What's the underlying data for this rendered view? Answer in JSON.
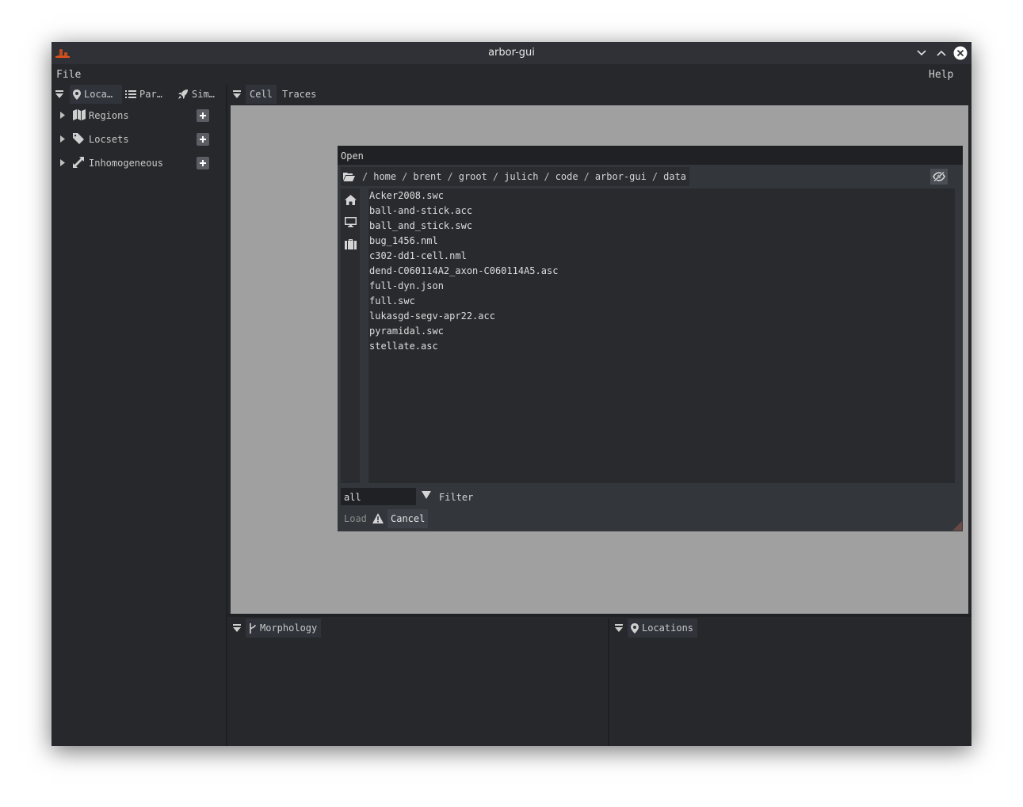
{
  "window": {
    "title": "arbor-gui"
  },
  "menu": {
    "file": "File",
    "help": "Help"
  },
  "left_panel": {
    "tabs": [
      {
        "label": "Loca…",
        "icon": "map-marker-icon"
      },
      {
        "label": "Par…",
        "icon": "list-icon"
      },
      {
        "label": "Sim…",
        "icon": "rocket-icon"
      }
    ],
    "tree": [
      {
        "label": "Regions",
        "icon": "map-icon"
      },
      {
        "label": "Locsets",
        "icon": "tag-icon"
      },
      {
        "label": "Inhomogeneous",
        "icon": "expand-arrows-icon"
      }
    ]
  },
  "center_panel": {
    "tabs": [
      "Cell",
      "Traces"
    ]
  },
  "open_dialog": {
    "title": "Open",
    "path": [
      "home",
      "brent",
      "groot",
      "julich",
      "code",
      "arbor-gui",
      "data"
    ],
    "path_separator": "/",
    "places": [
      "home-icon",
      "desktop-icon",
      "briefcase-icon"
    ],
    "files": [
      "Acker2008.swc",
      "ball-and-stick.acc",
      "ball_and_stick.swc",
      "bug_1456.nml",
      "c302-dd1-cell.nml",
      "dend-C060114A2_axon-C060114A5.asc",
      "full-dyn.json",
      "full.swc",
      "lukasgd-segv-apr22.acc",
      "pyramidal.swc",
      "stellate.asc"
    ],
    "filter": {
      "value": "all",
      "label": "Filter"
    },
    "buttons": {
      "load": "Load",
      "cancel": "Cancel"
    }
  },
  "bottom_left": {
    "tab": "Morphology"
  },
  "bottom_right": {
    "tab": "Locations"
  },
  "colors": {
    "background": "#26282b",
    "viewport": "#a0a0a0",
    "close_button": "#ffffff",
    "app_icon": "#e0521a"
  }
}
